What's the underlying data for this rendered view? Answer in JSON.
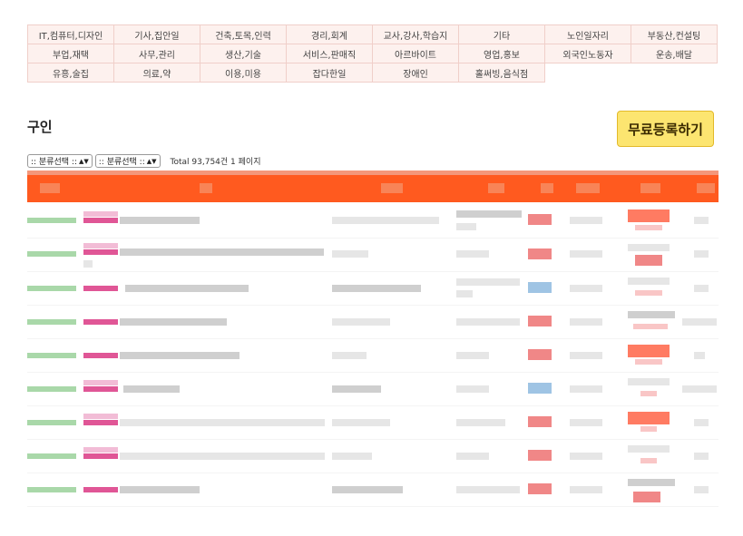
{
  "categories": [
    "IT,컴퓨터,디자인",
    "기사,집안일",
    "건축,토목,인력",
    "경리,회계",
    "교사,강사,학습지",
    "기타",
    "노인일자리",
    "부동산,컨설팅",
    "부업,재택",
    "사무,관리",
    "생산,기술",
    "서비스,판매직",
    "아르바이트",
    "영업,홍보",
    "외국인노동자",
    "운송,배달",
    "유흥,술집",
    "의료,약",
    "이용,미용",
    "잡다한일",
    "장애인",
    "홀써빙,음식점"
  ],
  "section_title": "구인",
  "register_button": "무료등록하기",
  "filters": {
    "select1": ":: 분류선택 ::",
    "select2": ":: 분류선택 ::",
    "total": "Total 93,754건 1 페이지"
  }
}
